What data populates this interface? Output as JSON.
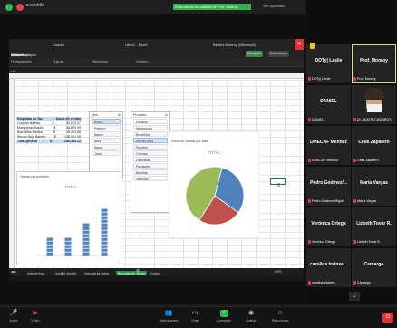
{
  "zoom": {
    "app_title": "z  contrib",
    "share_banner": "Está viendo la pantalla de Prof. Monroy",
    "view_options": "Ver Opciones"
  },
  "excel": {
    "title_left": "Cuadro",
    "file_name": "Libro1 - Excel",
    "account": "Beatriz Monroy (Microsoft)",
    "menu": [
      "Archivo",
      "Inicio",
      "Insertar",
      "Dibujar",
      "Diseño de página",
      "Fórmulas",
      "Datos",
      "Revisar",
      "Vista",
      "Desarrollador",
      "Ayuda",
      "Power Pivot"
    ],
    "share_label": "Compartir",
    "comments_label": "Comentarios",
    "ribbon": [
      "Portapapeles",
      "Fuente",
      "Alineación",
      "Número"
    ],
    "name_box": "H6",
    "pivot": {
      "col1": "Etiquetas de fila",
      "col2": "Suma de ventas",
      "rows": [
        {
          "label": "Cepillos Bambú",
          "cur": "$",
          "value": "54,223.37"
        },
        {
          "label": "Mangueras Santa",
          "cur": "$",
          "value": "58,800.99"
        },
        {
          "label": "Bombillos Bambú",
          "cur": "$",
          "value": "95,433.68"
        },
        {
          "label": "Serum Hoja Bambú",
          "cur": "$",
          "value": "138,001.08"
        }
      ],
      "total_label": "Total general",
      "total_cur": "$",
      "total_value": "346,459.12"
    },
    "slicer1": {
      "title": "Mes",
      "items": [
        "Enero",
        "Febrero",
        "Marzo",
        "Abril",
        "Mayo",
        "Junio"
      ],
      "selected": 0
    },
    "slicer2": {
      "title": "Producto",
      "items": [
        "Cepillos",
        "Mangueras",
        "Bombillos",
        "Serum Hoja",
        "Paneles",
        "Cremas",
        "Lámparas",
        "Parasoles",
        "Botellas",
        "Jabones"
      ],
      "selected": 3
    },
    "bar_chart": {
      "title": "Ventas por producto",
      "label": "TOTAL"
    },
    "pie_chart": {
      "title": "Suma de Ventas por Mes",
      "label": "TOTAL"
    },
    "selected_cell_value": "0",
    "sheets": [
      "Informe final",
      "Cepillos Bambú",
      "Mangueras Santa",
      "Resumen de Ventas",
      "Gráfico"
    ],
    "active_sheet": 3,
    "zoom_level": "100%"
  },
  "chart_data": [
    {
      "type": "bar",
      "title": "Ventas por producto",
      "categories": [
        "",
        "",
        "",
        ""
      ],
      "values": [
        54223,
        58801,
        95434,
        138001
      ],
      "ylim": [
        0,
        160000
      ],
      "grid": false
    },
    {
      "type": "pie",
      "title": "Suma de Ventas por Mes",
      "labels": [
        "",
        "",
        ""
      ],
      "values": [
        31,
        24,
        45
      ],
      "colors": [
        "#4f81bd",
        "#c0504d",
        "#9bbb59"
      ]
    }
  ],
  "gallery": [
    {
      "name": "DOTy| Leslie",
      "caption": "DOTy| Leslie",
      "active": false,
      "face": false
    },
    {
      "name": "Prof. Monroy",
      "caption": "Prof. Monroy",
      "active": true,
      "face": false
    },
    {
      "name": "DANIEL",
      "caption": "DANIEL",
      "active": false,
      "face": false
    },
    {
      "name": "",
      "caption": "Dr. BEATRIZ MONROY",
      "active": false,
      "face": true
    },
    {
      "name": "DMECAF Méndez",
      "caption": "DMECAF Méndez",
      "active": false,
      "face": false
    },
    {
      "name": "Celia Zapatero",
      "caption": "Celia Zapatero",
      "active": false,
      "face": false
    },
    {
      "name": "Pedro Godínez/...",
      "caption": "Pedro Godínez/Miguel",
      "active": false,
      "face": false
    },
    {
      "name": "María Vargas",
      "caption": "María Vargas",
      "active": false,
      "face": false
    },
    {
      "name": "Verónica Ortega",
      "caption": "Verónica Ortega",
      "active": false,
      "face": false
    },
    {
      "name": "Lizbeth Tovar R.",
      "caption": "Lizbeth Tovar R.",
      "active": false,
      "face": false
    },
    {
      "name": "carolina trainee...",
      "caption": "carolina trainee...",
      "active": false,
      "face": false
    },
    {
      "name": "Camargo",
      "caption": "Camargo",
      "active": false,
      "face": false
    }
  ],
  "bottom": {
    "mute": "Audio",
    "video": "Video",
    "participants": "Participantes",
    "chat": "Chat",
    "share": "Compartir",
    "record": "Grabar",
    "reactions": "Reacciones",
    "end": "Salir"
  }
}
